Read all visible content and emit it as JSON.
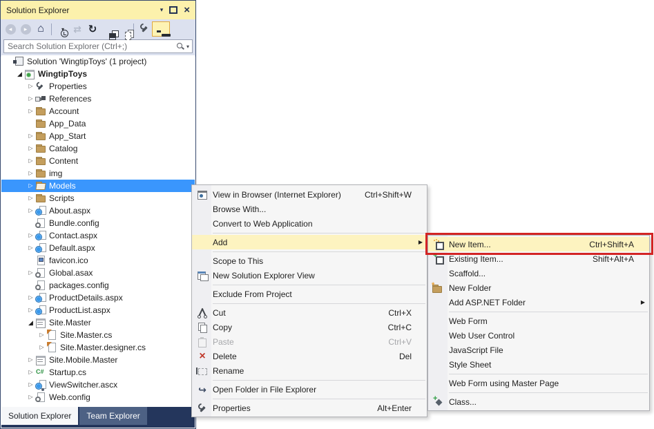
{
  "window": {
    "title": "Solution Explorer",
    "controls": [
      {
        "name": "window-position",
        "icon": "chevron-down-icon"
      },
      {
        "name": "maximize",
        "icon": "maximize-icon"
      },
      {
        "name": "close",
        "icon": "close-icon"
      }
    ]
  },
  "toolbar": {
    "buttons": [
      {
        "name": "back",
        "icon": "back-icon",
        "disabled": true
      },
      {
        "name": "forward",
        "icon": "forward-icon",
        "disabled": true
      },
      {
        "name": "home",
        "icon": "home-icon"
      },
      {
        "type": "separator"
      },
      {
        "name": "pending-changes-filter",
        "icon": "clock-filter-icon",
        "caret": true
      },
      {
        "name": "sync-with-active-document",
        "icon": "sync-arrows-icon",
        "disabled": true
      },
      {
        "name": "refresh",
        "icon": "refresh-icon"
      },
      {
        "name": "collapse-all",
        "icon": "collapse-all-icon"
      },
      {
        "name": "show-all-files",
        "icon": "show-all-files-icon"
      },
      {
        "type": "separator"
      },
      {
        "name": "properties",
        "icon": "wrench-icon"
      },
      {
        "name": "preview-selected-items",
        "icon": "preview-window-icon",
        "toggled": true
      }
    ]
  },
  "search": {
    "placeholder": "Search Solution Explorer (Ctrl+;)",
    "icon": "search-icon",
    "caret_icon": "chevron-down-icon"
  },
  "tree": {
    "items": [
      {
        "label": "Solution 'WingtipToys' (1 project)",
        "icon": "solution-icon",
        "level": 0,
        "expander": "none"
      },
      {
        "label": "WingtipToys",
        "icon": "project-icon",
        "level": 1,
        "expander": "expanded",
        "bold": true
      },
      {
        "label": "Properties",
        "icon": "wrench-icon",
        "level": 2,
        "expander": "collapsed"
      },
      {
        "label": "References",
        "icon": "references-icon",
        "level": 2,
        "expander": "collapsed"
      },
      {
        "label": "Account",
        "icon": "folder-icon",
        "level": 2,
        "expander": "collapsed"
      },
      {
        "label": "App_Data",
        "icon": "folder-icon",
        "level": 2,
        "expander": "none"
      },
      {
        "label": "App_Start",
        "icon": "folder-icon",
        "level": 2,
        "expander": "collapsed"
      },
      {
        "label": "Catalog",
        "icon": "folder-icon",
        "level": 2,
        "expander": "collapsed"
      },
      {
        "label": "Content",
        "icon": "folder-icon",
        "level": 2,
        "expander": "collapsed"
      },
      {
        "label": "img",
        "icon": "folder-icon",
        "level": 2,
        "expander": "collapsed"
      },
      {
        "label": "Models",
        "icon": "folder-open-icon",
        "level": 2,
        "expander": "collapsed",
        "selected": true
      },
      {
        "label": "Scripts",
        "icon": "folder-icon",
        "level": 2,
        "expander": "collapsed"
      },
      {
        "label": "About.aspx",
        "icon": "aspx-page-icon",
        "level": 2,
        "expander": "collapsed"
      },
      {
        "label": "Bundle.config",
        "icon": "config-file-icon",
        "level": 2,
        "expander": "none"
      },
      {
        "label": "Contact.aspx",
        "icon": "aspx-page-icon",
        "level": 2,
        "expander": "collapsed"
      },
      {
        "label": "Default.aspx",
        "icon": "aspx-page-icon",
        "level": 2,
        "expander": "collapsed"
      },
      {
        "label": "favicon.ico",
        "icon": "image-file-icon",
        "level": 2,
        "expander": "none"
      },
      {
        "label": "Global.asax",
        "icon": "asax-file-icon",
        "level": 2,
        "expander": "collapsed"
      },
      {
        "label": "packages.config",
        "icon": "config-file-icon",
        "level": 2,
        "expander": "none"
      },
      {
        "label": "ProductDetails.aspx",
        "icon": "aspx-page-icon",
        "level": 2,
        "expander": "collapsed"
      },
      {
        "label": "ProductList.aspx",
        "icon": "aspx-page-icon",
        "level": 2,
        "expander": "collapsed"
      },
      {
        "label": "Site.Master",
        "icon": "master-page-icon",
        "level": 2,
        "expander": "expanded"
      },
      {
        "label": "Site.Master.cs",
        "icon": "cs-file-icon",
        "level": 3,
        "expander": "collapsed"
      },
      {
        "label": "Site.Master.designer.cs",
        "icon": "cs-file-icon",
        "level": 3,
        "expander": "collapsed"
      },
      {
        "label": "Site.Mobile.Master",
        "icon": "master-page-icon",
        "level": 2,
        "expander": "collapsed"
      },
      {
        "label": "Startup.cs",
        "icon": "csharp-file-icon",
        "level": 2,
        "expander": "collapsed"
      },
      {
        "label": "ViewSwitcher.ascx",
        "icon": "ascx-control-icon",
        "level": 2,
        "expander": "collapsed"
      },
      {
        "label": "Web.config",
        "icon": "config-file-icon",
        "level": 2,
        "expander": "collapsed"
      }
    ]
  },
  "tabs": [
    {
      "label": "Solution Explorer",
      "active": true
    },
    {
      "label": "Team Explorer",
      "active": false
    }
  ],
  "context_menu": {
    "items": [
      {
        "icon": "browser-icon",
        "label": "View in Browser (Internet Explorer)",
        "shortcut": "Ctrl+Shift+W"
      },
      {
        "label": "Browse With..."
      },
      {
        "label": "Convert to Web Application"
      },
      {
        "type": "separator"
      },
      {
        "label": "Add",
        "submenu": true,
        "highlighted": true
      },
      {
        "type": "separator"
      },
      {
        "label": "Scope to This"
      },
      {
        "icon": "new-view-icon",
        "label": "New Solution Explorer View"
      },
      {
        "type": "separator"
      },
      {
        "label": "Exclude From Project"
      },
      {
        "type": "separator"
      },
      {
        "icon": "cut-icon",
        "label": "Cut",
        "shortcut": "Ctrl+X"
      },
      {
        "icon": "copy-icon",
        "label": "Copy",
        "shortcut": "Ctrl+C"
      },
      {
        "icon": "paste-icon",
        "label": "Paste",
        "shortcut": "Ctrl+V",
        "disabled": true
      },
      {
        "icon": "delete-icon",
        "label": "Delete",
        "shortcut": "Del"
      },
      {
        "icon": "rename-icon",
        "label": "Rename"
      },
      {
        "type": "separator"
      },
      {
        "icon": "open-folder-icon",
        "label": "Open Folder in File Explorer"
      },
      {
        "type": "separator"
      },
      {
        "icon": "wrench-icon",
        "label": "Properties",
        "shortcut": "Alt+Enter"
      }
    ]
  },
  "add_submenu": {
    "items": [
      {
        "icon": "new-item-icon",
        "label": "New Item...",
        "shortcut": "Ctrl+Shift+A",
        "highlighted": true,
        "annotated": true
      },
      {
        "icon": "existing-item-icon",
        "label": "Existing Item...",
        "shortcut": "Shift+Alt+A"
      },
      {
        "label": "Scaffold..."
      },
      {
        "icon": "new-folder-icon",
        "label": "New Folder"
      },
      {
        "label": "Add ASP.NET Folder",
        "submenu": true
      },
      {
        "type": "separator"
      },
      {
        "label": "Web Form"
      },
      {
        "label": "Web User Control"
      },
      {
        "label": "JavaScript File"
      },
      {
        "label": "Style Sheet"
      },
      {
        "type": "separator"
      },
      {
        "label": "Web Form using Master Page"
      },
      {
        "type": "separator"
      },
      {
        "icon": "class-icon",
        "label": "Class..."
      }
    ]
  },
  "annotation": {
    "color": "#d32424",
    "target": "New Item..."
  },
  "colors": {
    "titlebar": "#fcf1ac",
    "toolbar": "#dce1ef",
    "selection": "#3a96fd",
    "menu_highlight": "#fdf3c0",
    "tab_strip": "#24365c",
    "inactive_tab": "#4d6184",
    "folder": "#c49e5d"
  }
}
